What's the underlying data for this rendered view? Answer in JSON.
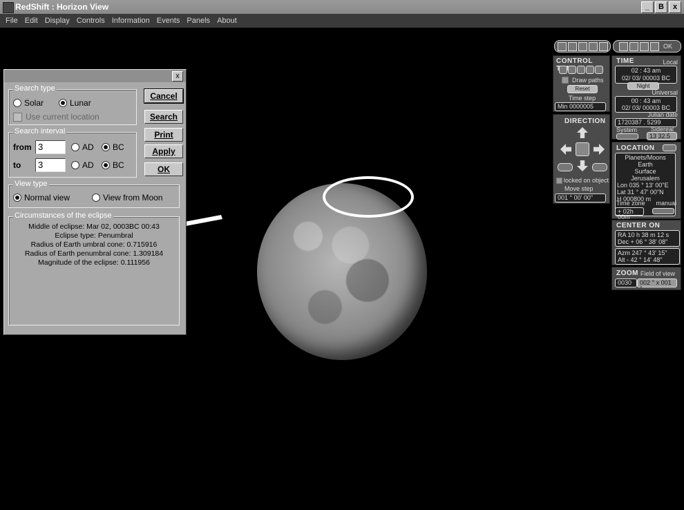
{
  "window": {
    "title": "RedShift : Horizon View",
    "buttons": [
      "_",
      "В",
      "x"
    ]
  },
  "menu": [
    "File",
    "Edit",
    "Display",
    "Controls",
    "Information",
    "Events",
    "Panels",
    "About"
  ],
  "dialog": {
    "close_label": "x",
    "search_type": {
      "label": "Search type",
      "solar": "Solar",
      "lunar": "Lunar",
      "selected": "Lunar",
      "use_current_location": "Use current location"
    },
    "search_interval": {
      "label": "Search interval",
      "from_label": "from",
      "from_value": "3",
      "to_label": "to",
      "to_value": "3",
      "ad": "AD",
      "bc": "BC"
    },
    "view_type": {
      "label": "View type",
      "normal": "Normal view",
      "from_moon": "View from Moon",
      "selected": "Normal view"
    },
    "circumstances": {
      "label": "Circumstances of the eclipse",
      "lines": [
        "Middle of eclipse: Mar 02, 0003BC 00:43",
        "Eclipse type: Penumbral",
        "Radius of Earth umbral cone: 0.715916",
        "Radius of Earth penumbral cone: 1.309184",
        "Magnitude of the eclipse: 0.111956"
      ]
    },
    "buttons": {
      "cancel": "Cancel",
      "search": "Search",
      "print": "Print",
      "apply": "Apply",
      "ok": "OK"
    }
  },
  "control_time": {
    "title": "CONTROL TIME",
    "draw_paths": "Draw paths",
    "reset": "Reset",
    "time_step_label": "Time step",
    "time_step_value": "Min  0000005"
  },
  "time_panel": {
    "title": "TIME",
    "local_label": "Local",
    "local_time": "02 : 43 am",
    "local_date": "02/ 03/ 00003 BC",
    "night": "Night",
    "universal_label": "Universal",
    "universal_time": "00 : 43 am",
    "universal_date": "02/ 03/ 00003 BC",
    "julian_label": "Julian date",
    "julian_value": "1720387 . 5299",
    "system_label": "System",
    "sidereal_label": "Sidereal",
    "sidereal_value": "13  32.5"
  },
  "direction": {
    "title": "DIRECTION",
    "locked": "locked on object",
    "move_step_label": "Move step",
    "move_step_value": "001 ° 00' 00\""
  },
  "location": {
    "title": "LOCATION",
    "lines": [
      "Planets/Moons",
      "Earth",
      "Surface",
      "Jerusalem"
    ],
    "lon_label": "Lon",
    "lon_value": "035 ° 13' 00\"E",
    "lat_label": "Lat",
    "lat_value": "31 ° 47' 00\"N",
    "h_label": "H",
    "h_value": "000800  m",
    "timezone_label": "Time zone",
    "manual": "manual",
    "timezone_value": "+ 02h 00m"
  },
  "center_on": {
    "title": "CENTER ON",
    "ra_label": "RA",
    "ra_value": "10 h 38 m 12 s",
    "dec_label": "Dec",
    "dec_value": "+ 06 ° 38' 08\"",
    "azm_label": "Azm",
    "azm_value": "247 ° 43' 15\"",
    "alt_label": "Alt",
    "alt_value": "- 42 ° 14' 48\""
  },
  "zoom": {
    "title": "ZOOM",
    "fov_label": "Field of view",
    "zoom_value": "0030",
    "fov_value": "002 ° x 001 °"
  },
  "toolbars": {
    "right_ok": "OK"
  }
}
